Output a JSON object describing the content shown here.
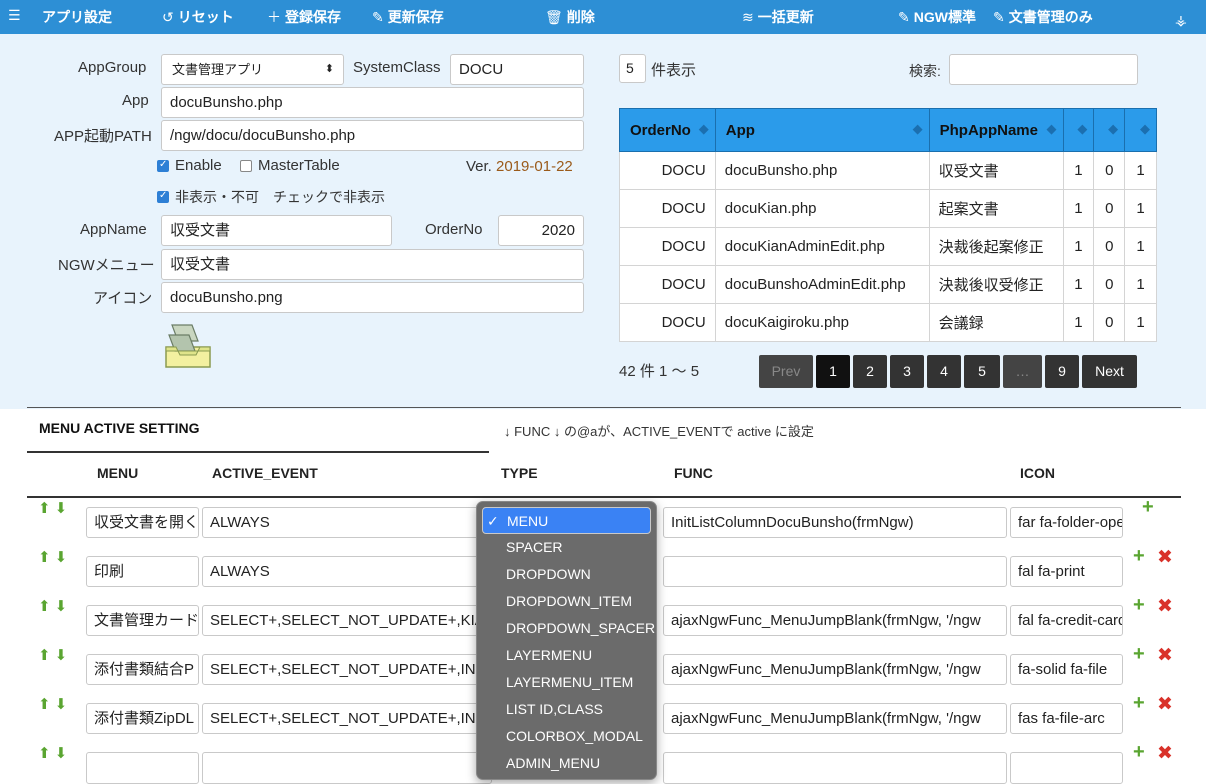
{
  "toolbar": {
    "menu_icon": "☰",
    "app_settings": "アプリ設定",
    "reset": "リセット",
    "register_save": "登録保存",
    "update_save": "更新保存",
    "delete": "削除",
    "bulk_update": "一括更新",
    "ngw_standard": "NGW標準",
    "doc_only": "文書管理のみ"
  },
  "form": {
    "appgroup_label": "AppGroup",
    "appgroup_value": "文書管理アプリ",
    "systemclass_label": "SystemClass",
    "systemclass_value": "DOCU",
    "app_label": "App",
    "app_value": "docuBunsho.php",
    "path_label": "APP起動PATH",
    "path_value": "/ngw/docu/docuBunsho.php",
    "enable_label": "Enable",
    "enable_checked": true,
    "mastertable_label": "MasterTable",
    "mastertable_checked": false,
    "ver_label": "Ver.",
    "ver_value": "2019-01-22",
    "hidden_label": "非表示・不可　チェックで非表示",
    "hidden_checked": true,
    "appname_label": "AppName",
    "appname_value": "収受文書",
    "orderno_label": "OrderNo",
    "orderno_value": "2020",
    "ngwmenu_label": "NGWメニュー",
    "ngwmenu_value": "収受文書",
    "icon_label": "アイコン",
    "icon_value": "docuBunsho.png"
  },
  "list": {
    "page_size": "5",
    "page_size_suffix": "件表示",
    "search_label": "検索:",
    "search_value": "",
    "columns": [
      "OrderNo",
      "App",
      "PhpAppName",
      "",
      "",
      ""
    ],
    "rows": [
      [
        "DOCU",
        "docuBunsho.php",
        "収受文書",
        "1",
        "0",
        "1"
      ],
      [
        "DOCU",
        "docuKian.php",
        "起案文書",
        "1",
        "0",
        "1"
      ],
      [
        "DOCU",
        "docuKianAdminEdit.php",
        "決裁後起案修正",
        "1",
        "0",
        "1"
      ],
      [
        "DOCU",
        "docuBunshoAdminEdit.php",
        "決裁後収受修正",
        "1",
        "0",
        "1"
      ],
      [
        "DOCU",
        "docuKaigiroku.php",
        "会議録",
        "1",
        "0",
        "1"
      ]
    ],
    "summary": "42 件 1 〜 5",
    "pagination": [
      "Prev",
      "1",
      "2",
      "3",
      "4",
      "5",
      "…",
      "9",
      "Next"
    ]
  },
  "menu_setting": {
    "tab_label": "MENU ACTIVE SETTING",
    "note": "↓ FUNC ↓ の@aが、ACTIVE_EVENTで active に設定",
    "headers": [
      "MENU",
      "ACTIVE_EVENT",
      "TYPE",
      "FUNC",
      "ICON"
    ],
    "rows": [
      {
        "menu": "収受文書を開く",
        "event": "ALWAYS",
        "func": "InitListColumnDocuBunsho(frmNgw)",
        "icon": "far fa-folder-open"
      },
      {
        "menu": "印刷",
        "event": "ALWAYS",
        "func": "",
        "icon": "fal fa-print"
      },
      {
        "menu": "文書管理カード",
        "event": "SELECT+,SELECT_NOT_UPDATE+,KIAN",
        "func": "ajaxNgwFunc_MenuJumpBlank(frmNgw, '/ngw",
        "icon": "fal fa-credit-card"
      },
      {
        "menu": "添付書類結合P",
        "event": "SELECT+,SELECT_NOT_UPDATE+,INS",
        "func": "ajaxNgwFunc_MenuJumpBlank(frmNgw, '/ngw",
        "icon": "fa-solid fa-file"
      },
      {
        "menu": "添付書類ZipDL",
        "event": "SELECT+,SELECT_NOT_UPDATE+,INS",
        "func": "ajaxNgwFunc_MenuJumpBlank(frmNgw, '/ngw",
        "icon": "fas fa-file-arc"
      },
      {
        "menu": "",
        "event": "",
        "func": "",
        "icon": ""
      }
    ],
    "type_options": [
      "MENU",
      "SPACER",
      "DROPDOWN",
      "DROPDOWN_ITEM",
      "DROPDOWN_SPACER",
      "LAYERMENU",
      "LAYERMENU_ITEM",
      "LIST ID,CLASS",
      "COLORBOX_MODAL",
      "ADMIN_MENU"
    ],
    "type_selected": "MENU"
  }
}
